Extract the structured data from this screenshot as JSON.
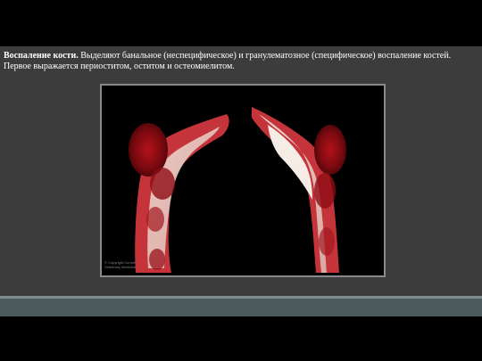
{
  "slide": {
    "caption_lead": "Воспаление кости.",
    "caption_body": " Выделяют банальное (неспецифическое) и гранулематозное (специфическое) воспаление костей. Первое выражается периоститом, оститом и остеомиелитом."
  },
  "photo": {
    "watermark_line1": "© Copyright Cornell",
    "watermark_line2": "Veterinary Medicine"
  },
  "colors": {
    "slide_background": "#3c3c3c",
    "page_background": "#000000",
    "bottom_bar": "#4d5a5b",
    "bottom_bar_border": "#7f8c8c",
    "photo_border": "#8a8a8a"
  }
}
